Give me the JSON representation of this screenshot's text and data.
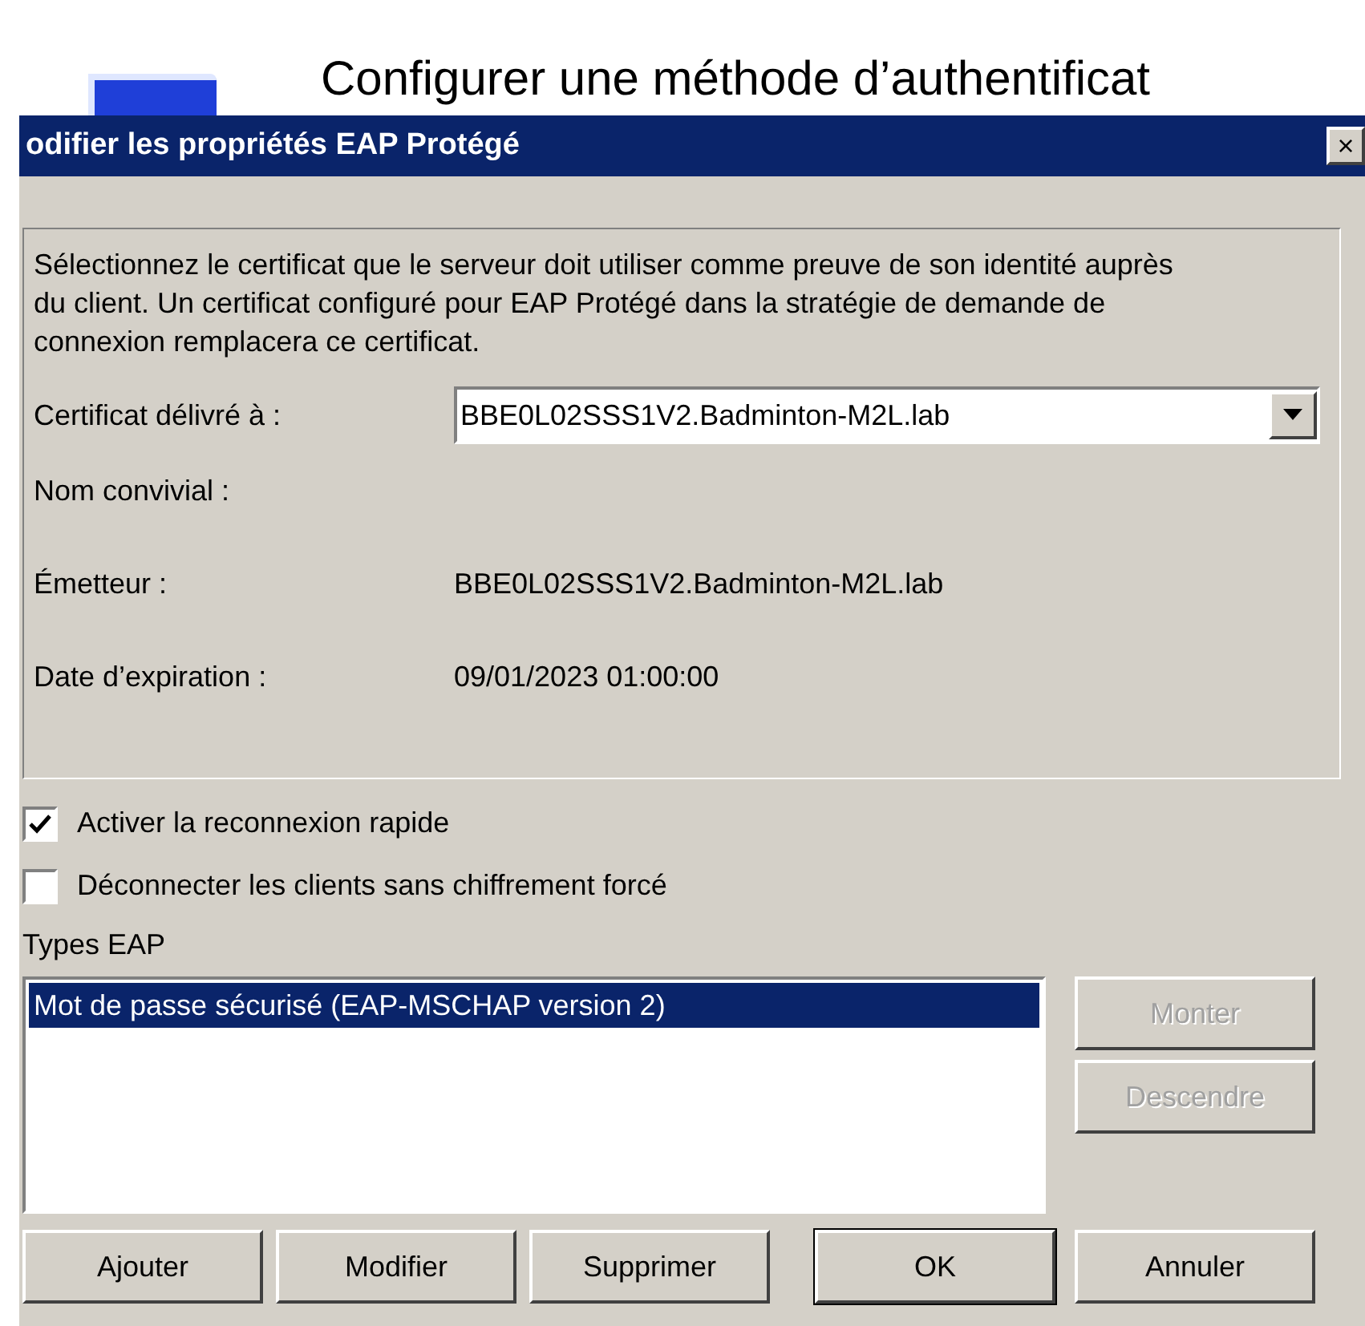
{
  "background_window": {
    "heading": "Configurer une méthode d’authentificat"
  },
  "dialog": {
    "title": "odifier les propriétés EAP Protégé",
    "close": "×"
  },
  "certificate_group": {
    "description": "Sélectionnez le certificat que le serveur doit utiliser comme preuve de son identité auprès du client. Un certificat configuré pour EAP Protégé dans la stratégie de demande de connexion remplacera ce certificat.",
    "issued_to": {
      "label": "Certificat délivré à :",
      "value": "BBE0L02SSS1V2.Badminton-M2L.lab"
    },
    "fields": [
      {
        "label": "Nom convivial :"
      },
      {
        "label": "Émetteur :",
        "value": "BBE0L02SSS1V2.Badminton-M2L.lab"
      },
      {
        "label": "Date d’expiration :",
        "value": "09/01/2023 01:00:00"
      }
    ]
  },
  "options": [
    {
      "label": "Activer la reconnexion rapide",
      "checked": true
    },
    {
      "label": "Déconnecter les clients sans chiffrement forcé",
      "checked": false
    }
  ],
  "eap_types": {
    "label": "Types EAP",
    "items": [
      {
        "label": "Mot de passe sécurisé (EAP-MSCHAP version 2)",
        "selected": true
      }
    ],
    "side_buttons": [
      {
        "label": "Monter",
        "disabled": true
      },
      {
        "label": "Descendre",
        "disabled": true
      }
    ]
  },
  "buttons": [
    {
      "label": "Ajouter",
      "default": false
    },
    {
      "label": "Modifier",
      "default": false
    },
    {
      "label": "Supprimer",
      "default": false
    },
    {
      "label": "OK",
      "default": true
    },
    {
      "label": "Annuler",
      "default": false
    }
  ]
}
